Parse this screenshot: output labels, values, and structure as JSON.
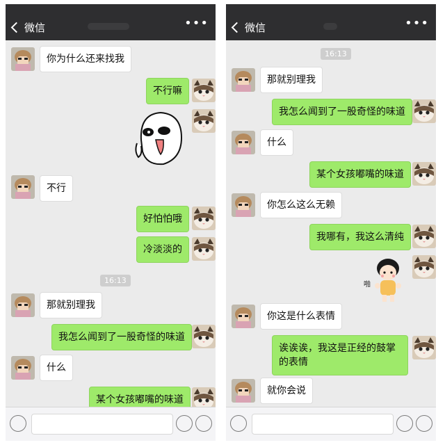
{
  "header": {
    "back_label": "微信",
    "more_label": "•••"
  },
  "timestamps": [
    "16:13",
    "16:13"
  ],
  "left_messages": [
    "你为什么还来找我",
    "不行嘛",
    "不行",
    "好怕怕哦",
    "冷淡淡的",
    "那就别理我",
    "我怎么闻到了一股奇怪的味道",
    "什么",
    "某个女孩嘟嘴的味道"
  ],
  "right_messages": [
    "那就别理我",
    "我怎么闻到了一股奇怪的味道",
    "什么",
    "某个女孩嘟嘴的味道",
    "你怎么这么无赖",
    "我哪有，我这么清纯",
    "你这是什么表情",
    "诶诶诶，我这是正经的鼓掌的表情",
    "就你会说"
  ],
  "stickers": {
    "left_sticker_icon": "crying-face-sticker-icon",
    "right_sticker_icon": "cartoon-girl-clapping-sticker-icon",
    "right_sticker_text": "啪"
  },
  "colors": {
    "bubble_out": "#9eea6a",
    "bubble_in": "#ffffff",
    "chat_bg": "#ebebeb",
    "topbar": "#2e2e30"
  },
  "icons": {
    "voice": "voice-icon",
    "emoji": "emoji-icon",
    "plus": "plus-icon",
    "back": "chevron-left-icon",
    "more": "more-icon"
  }
}
